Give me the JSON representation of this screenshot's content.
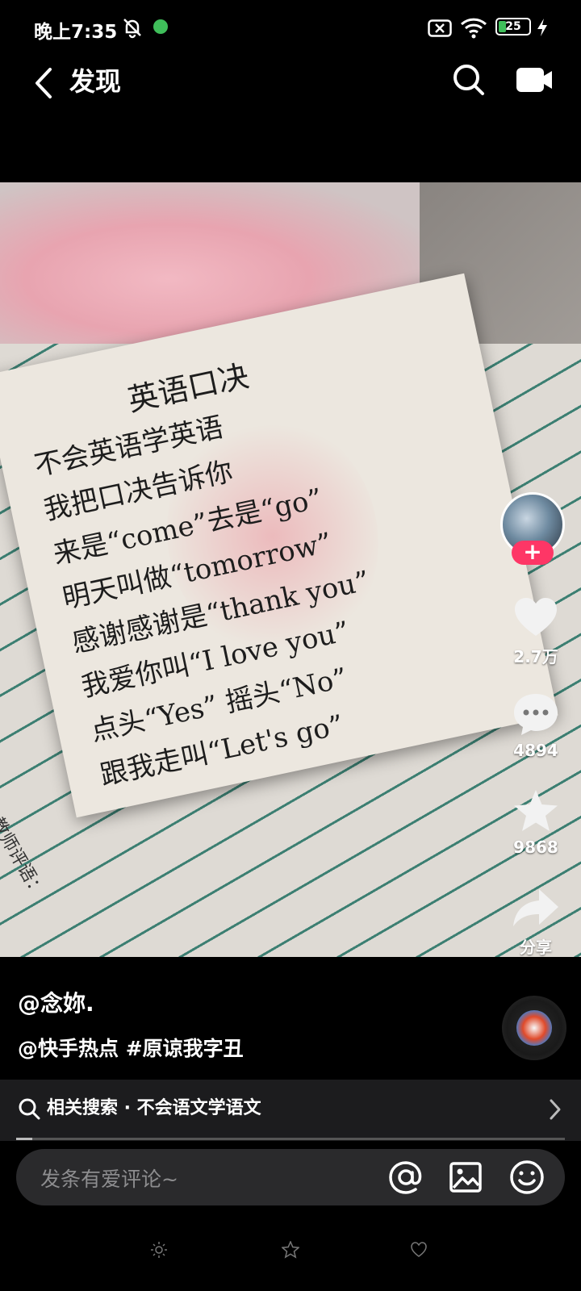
{
  "status_bar": {
    "time": "晚上7:35",
    "battery": "25",
    "battery_level": 0.25,
    "accent": "#3fbe5a"
  },
  "header": {
    "title": "发现",
    "icons": [
      "back-icon",
      "search-icon",
      "camera-icon"
    ]
  },
  "note": {
    "lines": [
      "英语口决",
      "不会英语学英语",
      "我把口决告诉你",
      "来是“come”去是“go”",
      "明天叫做“tomorrow”",
      "感谢感谢是“thank you”",
      "我爱你叫“I love you”",
      "点头“Yes” 摇头“No”",
      "跟我走叫“Let's go”"
    ],
    "stamp": "教师评语："
  },
  "actions": {
    "follow": "+",
    "likes": "2.7万",
    "comments": "4894",
    "favorites": "9868",
    "share": "分享",
    "follow_color": "#fe3666"
  },
  "caption": {
    "author": "@念妳.",
    "tags": "@快手热点 #原谅我字丑"
  },
  "related_search": {
    "text": "相关搜索 · 不会语文学语文"
  },
  "playback": {
    "progress": 0.03
  },
  "comment_bar": {
    "placeholder": "发条有爱评论~"
  }
}
